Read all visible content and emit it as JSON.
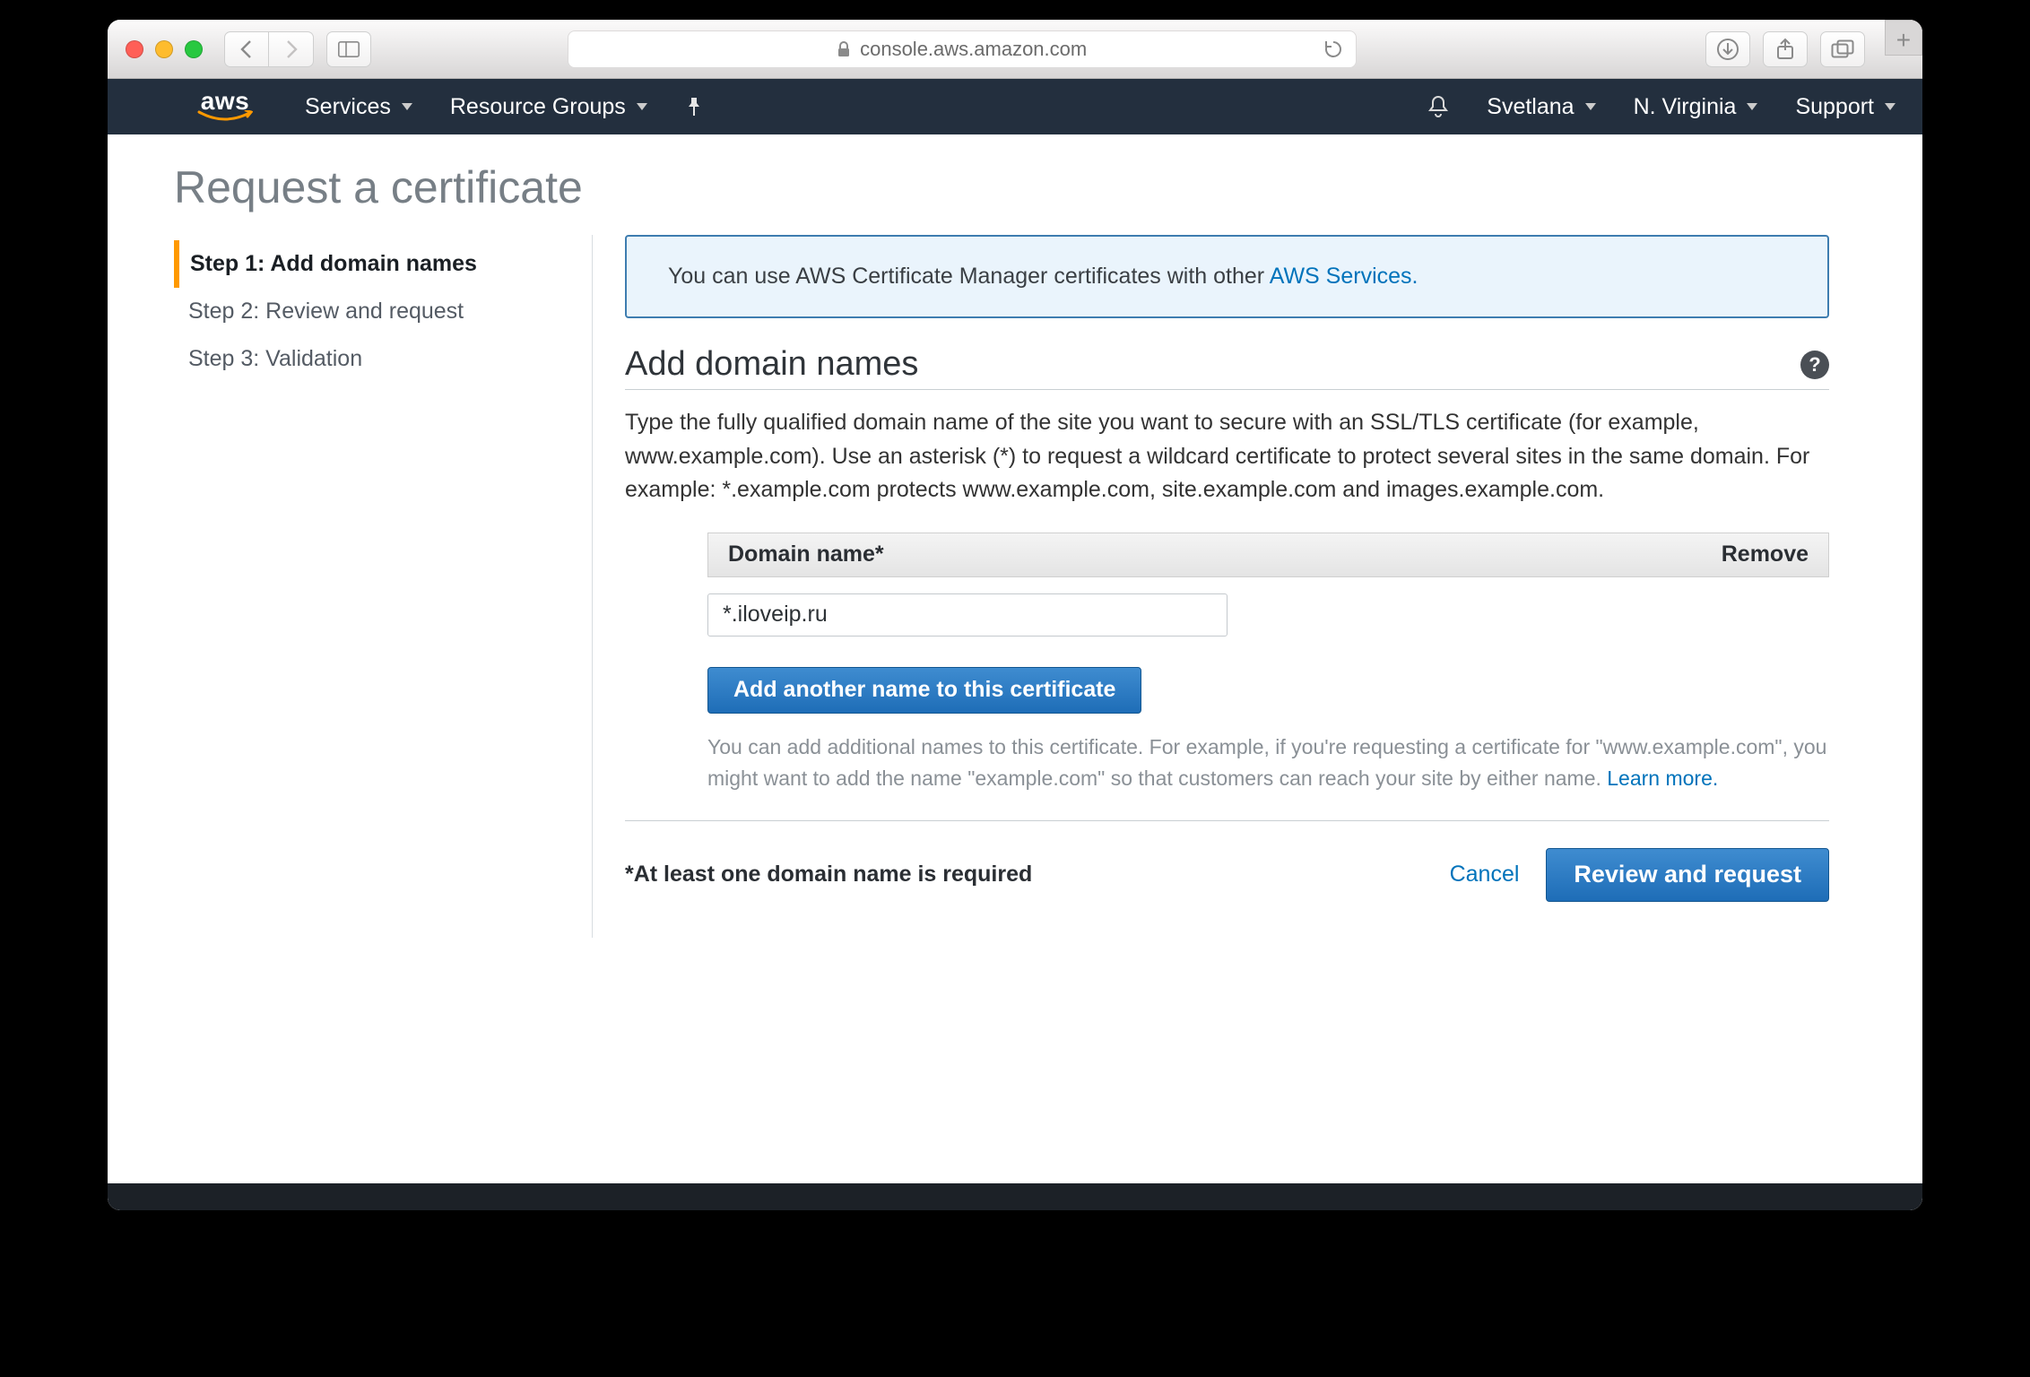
{
  "safari": {
    "url": "console.aws.amazon.com"
  },
  "aws_nav": {
    "logo": "aws",
    "services": "Services",
    "resource_groups": "Resource Groups",
    "user": "Svetlana",
    "region": "N. Virginia",
    "support": "Support"
  },
  "page": {
    "title": "Request a certificate"
  },
  "steps": {
    "items": [
      {
        "label": "Step 1: Add domain names",
        "active": true
      },
      {
        "label": "Step 2: Review and request",
        "active": false
      },
      {
        "label": "Step 3: Validation",
        "active": false
      }
    ]
  },
  "info": {
    "prefix": "You can use AWS Certificate Manager certificates with other ",
    "link": "AWS Services."
  },
  "section": {
    "heading": "Add domain names",
    "description": "Type the fully qualified domain name of the site you want to secure with an SSL/TLS certificate (for example, www.example.com). Use an asterisk (*) to request a wildcard certificate to protect several sites in the same domain. For example: *.example.com protects www.example.com, site.example.com and images.example.com."
  },
  "domain_table": {
    "col_name": "Domain name*",
    "col_remove": "Remove",
    "rows": [
      {
        "value": "*.iloveip.ru"
      }
    ]
  },
  "add_button": "Add another name to this certificate",
  "hint": {
    "text": "You can add additional names to this certificate. For example, if you're requesting a certificate for \"www.example.com\", you might want to add the name \"example.com\" so that customers can reach your site by either name. ",
    "link": "Learn more."
  },
  "footer": {
    "required_note": "*At least one domain name is required",
    "cancel": "Cancel",
    "review": "Review and request"
  }
}
